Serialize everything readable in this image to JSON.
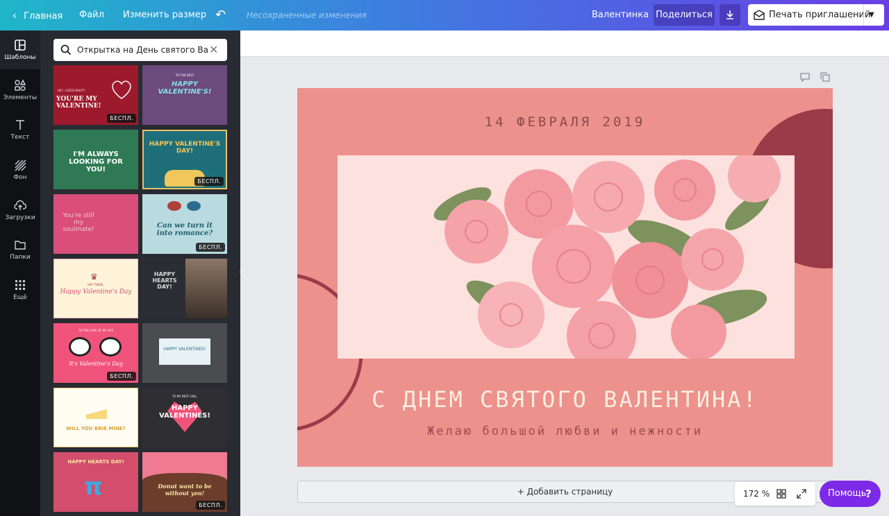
{
  "topbar": {
    "home": "Главная",
    "file": "Файл",
    "resize": "Изменить размер",
    "unsaved": "Несохраненные изменения",
    "design_name": "Валентинка",
    "share": "Поделиться",
    "print": "Печать приглашений"
  },
  "rail": {
    "templates": "Шаблоны",
    "elements": "Элементы",
    "text": "Текст",
    "background": "Фон",
    "uploads": "Загрузки",
    "folders": "Папки",
    "more": "Ещё"
  },
  "search": {
    "value": "Открытка на День святого Вален"
  },
  "templates": {
    "free_badge": "БЕСПЛ.",
    "items": [
      {
        "heading": "YOU'RE MY VALENTINE!",
        "kicker": "HEY, GUESS WHAT?"
      },
      {
        "heading": "HAPPY VALENTINE'S!",
        "kicker": "TO THE BEST"
      },
      {
        "heading": "I'M ALWAYS LOOKING FOR YOU!",
        "kicker": ""
      },
      {
        "heading": "HAPPY VALENTINE'S DAY!",
        "kicker": ""
      },
      {
        "heading": "You're still my soulmate!",
        "kicker": ""
      },
      {
        "heading": "Can we turn it into romance?",
        "kicker": ""
      },
      {
        "heading": "Happy Valentine's Day",
        "kicker": "HEY THERE,"
      },
      {
        "heading": "HAPPY HEARTS DAY!",
        "kicker": ""
      },
      {
        "heading": "It's Valentine's Day",
        "kicker": "TO THE LOVE OF MY LIFE"
      },
      {
        "heading": "HAPPY VALENTINES!",
        "kicker": ""
      },
      {
        "heading": "WILL YOU BRIE MINE?",
        "kicker": ""
      },
      {
        "heading": "HAPPY VALENTINES!",
        "kicker": "TO MY BEST GIRL,"
      },
      {
        "heading": "HAPPY HEARTS DAY!",
        "kicker": ""
      },
      {
        "heading": "Donut want to be without you!",
        "kicker": ""
      }
    ]
  },
  "card": {
    "date": "14 ФЕВРАЛЯ 2019",
    "title": "С ДНЕМ СВЯТОГО ВАЛЕНТИНА!",
    "subtitle": "Желаю большой любви и нежности"
  },
  "editor": {
    "add_page": "+ Добавить страницу",
    "zoom": "172 %",
    "help": "Помощь",
    "help_q": "?"
  },
  "colors": {
    "accent": "#7d2ae8",
    "card_bg": "#ec918b",
    "card_dark": "#9b3b4a"
  }
}
